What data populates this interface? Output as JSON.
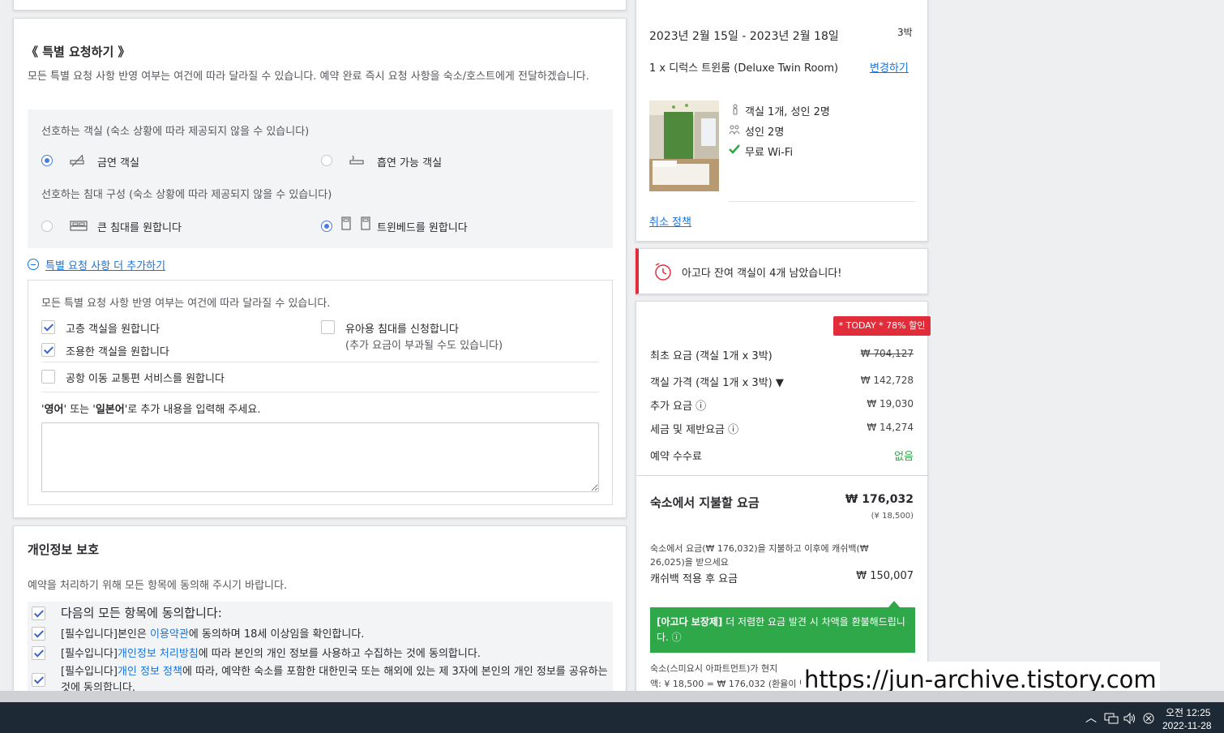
{
  "special": {
    "title": "《 특별 요청하기 》",
    "desc": "모든 특별 요청 사항 반영 여부는 여건에 따라 달라질 수 있습니다. 예약 완료 즉시 요청 사항을 숙소/호스트에게 전달하겠습니다.",
    "room_pref_label": "선호하는 객실 (숙소 상황에 따라 제공되지 않을 수 있습니다)",
    "room_options": [
      {
        "label": "금연 객실",
        "selected": true
      },
      {
        "label": "흡연 가능 객실",
        "selected": false
      }
    ],
    "bed_pref_label": "선호하는 침대 구성 (숙소 상황에 따라 제공되지 않을 수 있습니다)",
    "bed_options": [
      {
        "label": "큰 침대를 원합니다",
        "selected": false
      },
      {
        "label": "트윈베드를 원합니다",
        "selected": true
      }
    ],
    "more_link": "특별 요청 사항 더 추가하기",
    "more_desc": "모든 특별 요청 사항 반영 여부는 여건에 따라 달라질 수 있습니다.",
    "checks": [
      {
        "label": "고층 객실을 원합니다",
        "checked": true
      },
      {
        "label": "조용한 객실을 원합니다",
        "checked": true
      },
      {
        "label": "유아용 침대를 신청합니다",
        "sub": "(추가 요금이 부과될 수도 있습니다)",
        "checked": false
      },
      {
        "label": "공항 이동 교통편 서비스를 원합니다",
        "checked": false
      }
    ],
    "extra_prefix": "'",
    "extra_en": "영어",
    "extra_mid": "' 또는 '",
    "extra_jp": "일본어",
    "extra_suffix": "'로 추가 내용을 입력해 주세요.",
    "textarea_value": ""
  },
  "privacy": {
    "title": "개인정보 보호",
    "desc": "예약을 처리하기 위해 모든 항목에 동의해 주시기 바랍니다.",
    "agree_all": "다음의 모든 항목에 동의합니다:",
    "items": [
      {
        "prefix": "[필수입니다]본인은 ",
        "link": "이용약관",
        "suffix": "에 동의하며 18세 이상임을 확인합니다."
      },
      {
        "prefix": "[필수입니다]",
        "link": "개인정보 처리방침",
        "suffix": "에 따라 본인의 개인 정보를 사용하고 수집하는 것에 동의합니다."
      },
      {
        "prefix": "[필수입니다]",
        "link": "개인 정보 정책",
        "suffix": "에 따라, 예약한 숙소를 포함한 대한민국 또는 해외에 있는 제 3자에 본인의 개인 정보를 공유하는 것에 동의합니다."
      }
    ]
  },
  "booking": {
    "dates": "2023년 2월 15일 - 2023년 2월 18일",
    "nights": "3박",
    "room": "1 x 디럭스 트윈룸 (Deluxe Twin Room)",
    "change_link": "변경하기",
    "features": [
      "객실 1개, 성인 2명",
      "성인 2명",
      "무료 Wi-Fi"
    ],
    "cancel_link": "취소 정책"
  },
  "alert": {
    "text": "아고다 잔여 객실이 4개 남았습니다!"
  },
  "price": {
    "badge": "* TODAY * 78% 할인",
    "rows": [
      {
        "label": "최초 요금 (객실 1개 x 3박)",
        "value": "₩ 704,127"
      },
      {
        "label": "객실 가격 (객실 1개 x 3박) ▼",
        "value": "₩ 142,728"
      },
      {
        "label": "추가 요금 ⓘ",
        "value": "₩ 19,030"
      },
      {
        "label": "세금 및 제반요금 ⓘ",
        "value": "₩ 14,274"
      },
      {
        "label": "예약 수수료",
        "value": "없음"
      }
    ],
    "pay_label": "숙소에서 지불할 요금",
    "pay_value": "₩ 176,032",
    "pay_yen": "(¥ 18,500)",
    "cashback_note": "숙소에서 요금(₩ 176,032)을 지불하고 이후에 캐쉬백(₩ 26,025)을 받으세요",
    "after_label": "캐쉬백 적용 후 요금",
    "after_value": "₩ 150,007",
    "guarantee_bold": "[아고다 보장제]",
    "guarantee_text": " 더 저렴한 요금 발견 시 차액을 환불해드립니다. ⓘ",
    "footer1": "숙소(스미요시 아파트먼트)가 현지",
    "footer2": "액: ¥ 18,500 = ₩ 176,032 (환율이 변"
  },
  "watermark": "https://jun-archive.tistory.com",
  "taskbar": {
    "time": "오전 12:25",
    "date": "2022-11-28"
  },
  "colors": {
    "link": "#1a73d9",
    "badge": "#e12d39",
    "green": "#2fa84a",
    "alert_bar": "#e12d39"
  }
}
